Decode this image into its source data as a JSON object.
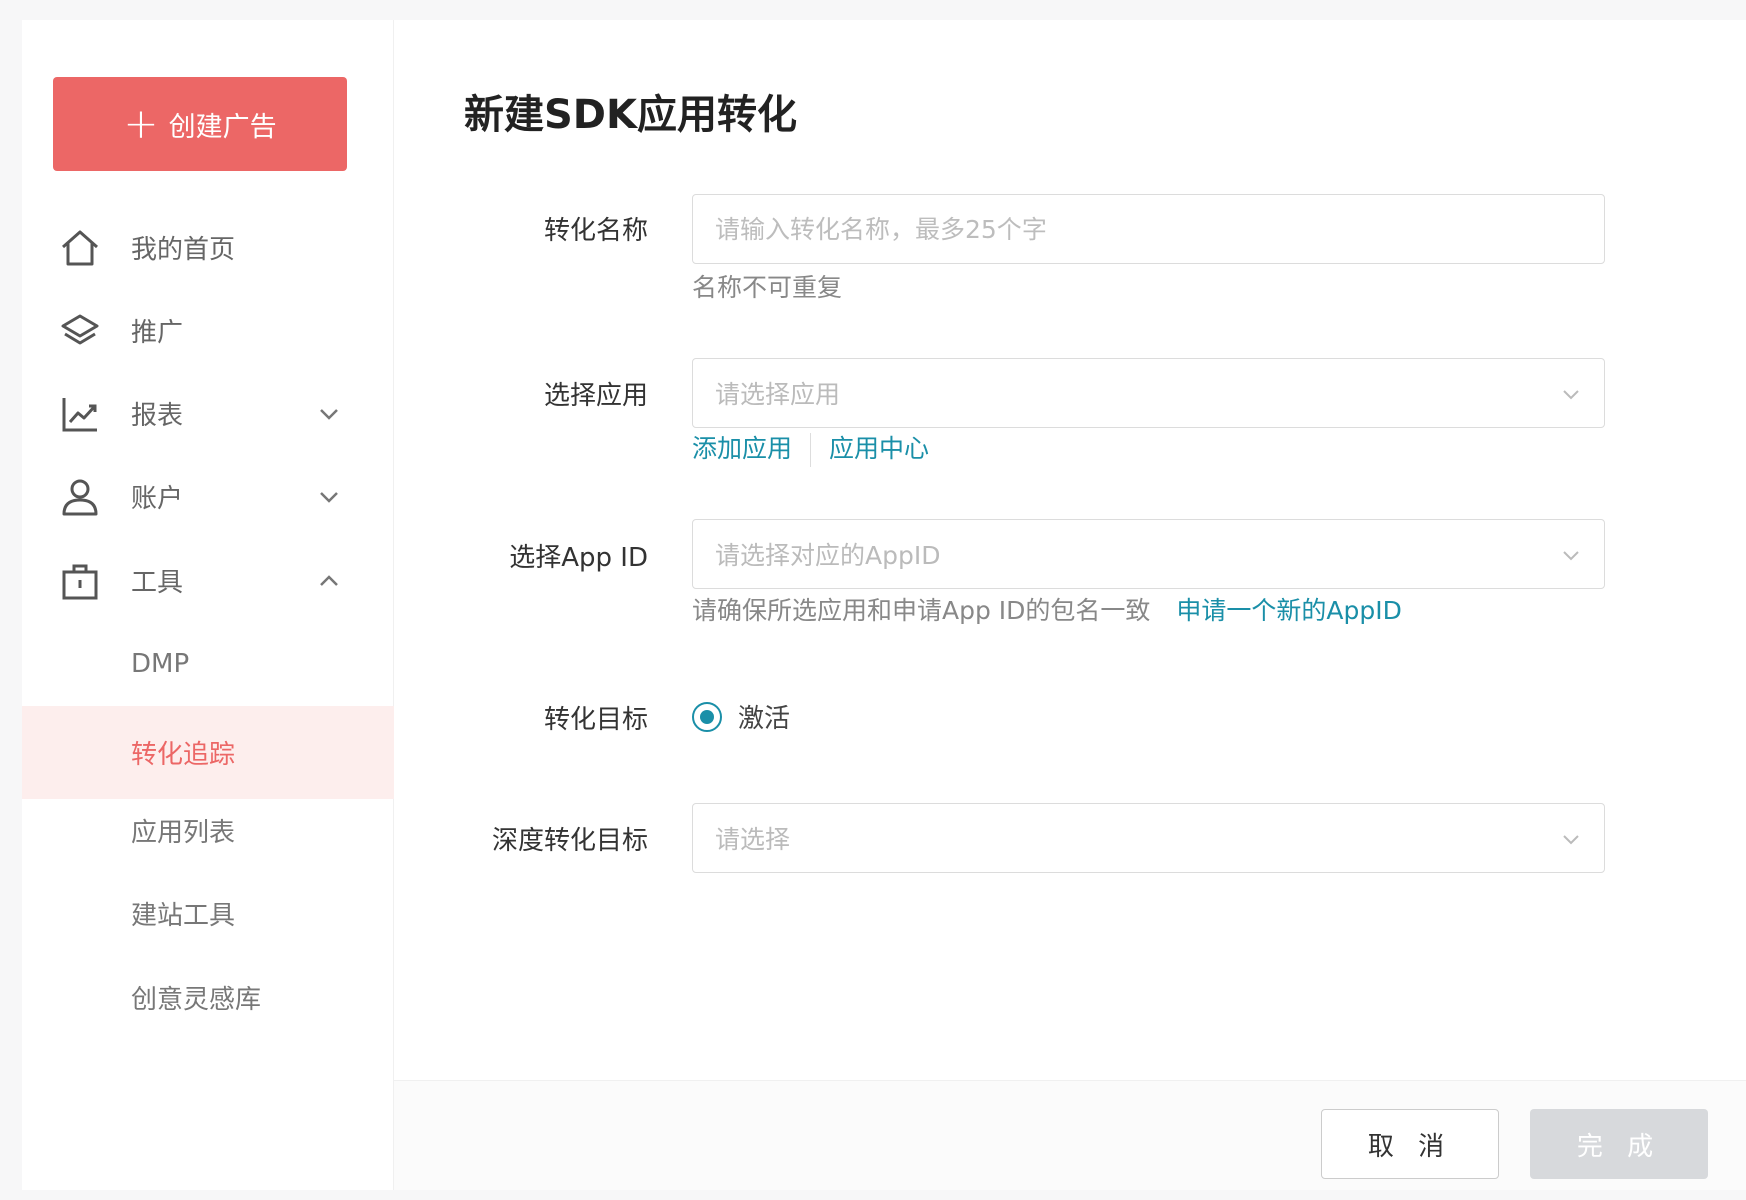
{
  "sidebar": {
    "create_label": "创建广告",
    "items": [
      {
        "label": "我的首页",
        "icon": "home-icon"
      },
      {
        "label": "推广",
        "icon": "layers-icon"
      },
      {
        "label": "报表",
        "icon": "chart-icon",
        "expand": "chevron-down-icon"
      },
      {
        "label": "账户",
        "icon": "user-icon",
        "expand": "chevron-down-icon"
      },
      {
        "label": "工具",
        "icon": "toolbox-icon",
        "expand": "chevron-up-icon"
      }
    ],
    "sub_items": [
      {
        "label": "DMP"
      },
      {
        "label": "转化追踪",
        "active": true
      },
      {
        "label": "应用列表"
      },
      {
        "label": "建站工具"
      },
      {
        "label": "创意灵感库"
      }
    ]
  },
  "main": {
    "title": "新建SDK应用转化",
    "form": {
      "name": {
        "label": "转化名称",
        "placeholder": "请输入转化名称，最多25个字",
        "hint": "名称不可重复"
      },
      "app": {
        "label": "选择应用",
        "placeholder": "请选择应用",
        "link_add": "添加应用",
        "link_center": "应用中心"
      },
      "appid": {
        "label": "选择App ID",
        "placeholder": "请选择对应的AppID",
        "hint": "请确保所选应用和申请App ID的包名一致",
        "link_new": "申请一个新的AppID"
      },
      "goal": {
        "label": "转化目标",
        "option": "激活"
      },
      "deep_goal": {
        "label": "深度转化目标",
        "placeholder": "请选择"
      }
    },
    "buttons": {
      "cancel": "取 消",
      "done": "完 成"
    }
  },
  "colors": {
    "accent_red": "#ec6766",
    "accent_teal": "#1a8fa8",
    "disabled": "#d7d9dc"
  }
}
